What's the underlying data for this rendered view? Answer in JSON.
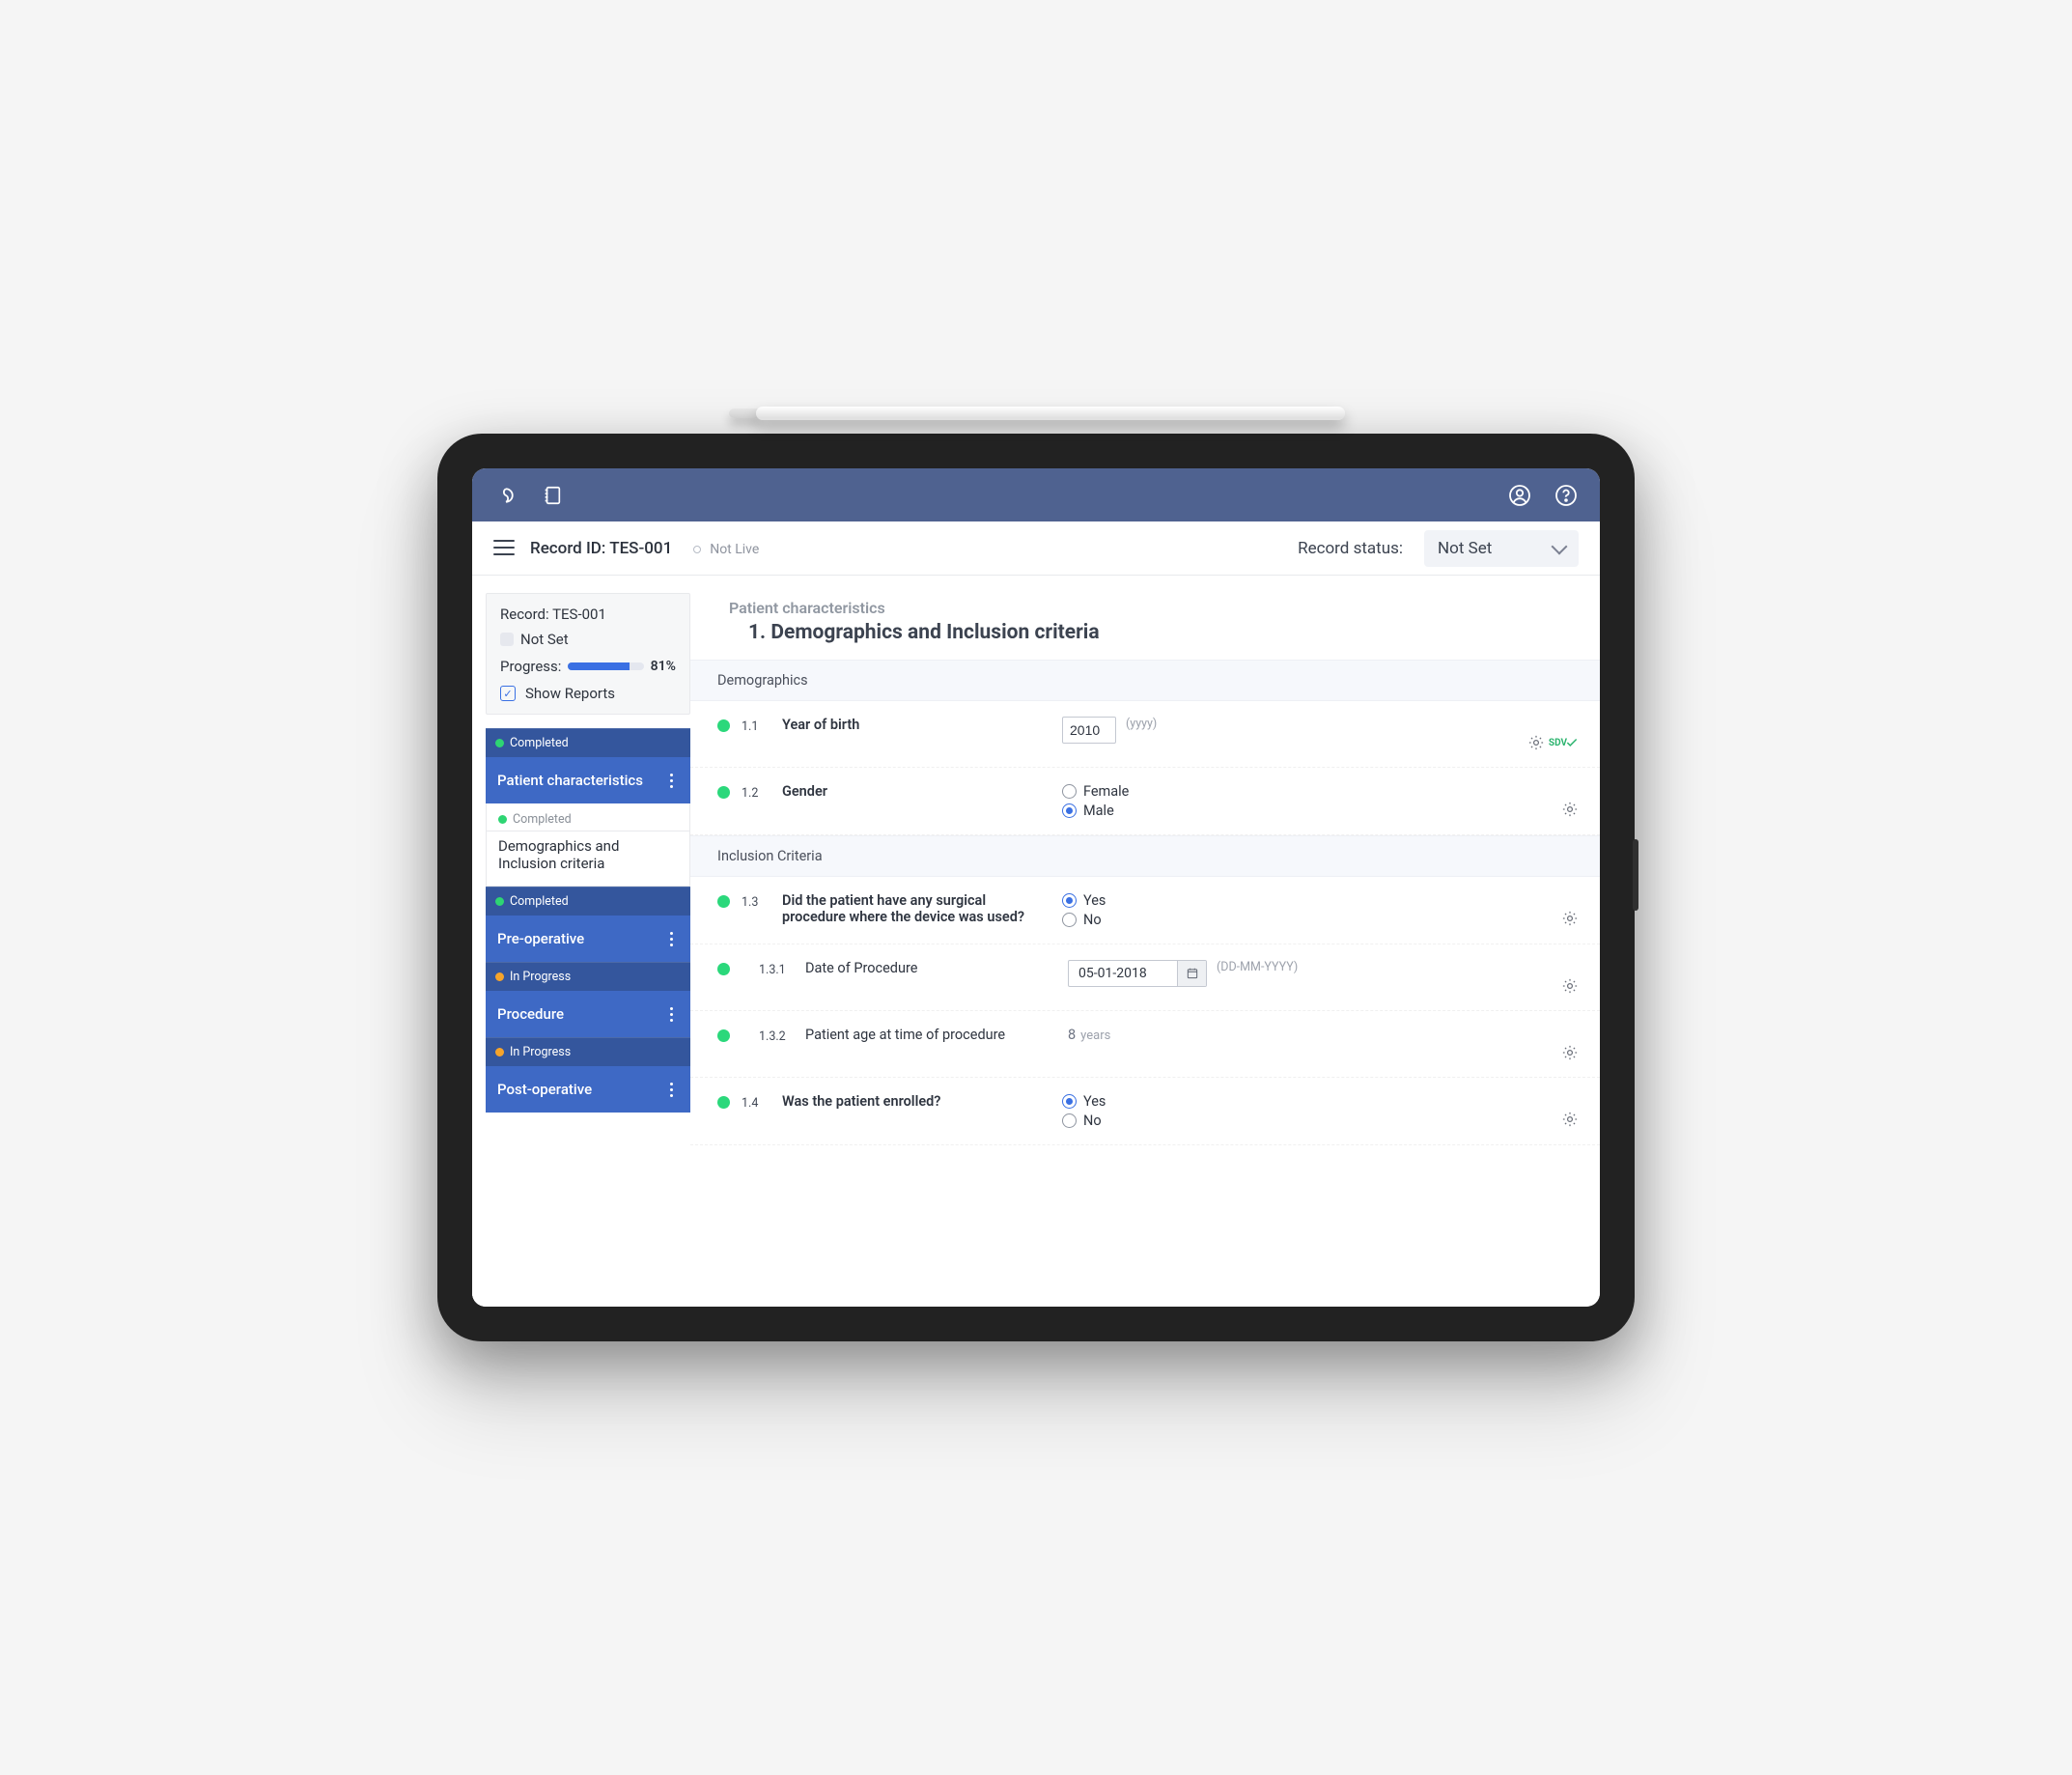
{
  "appbar": {},
  "toolbar": {
    "record_label": "Record ID: TES-001",
    "live_label": "Not Live",
    "status_label": "Record status:",
    "status_value": "Not Set"
  },
  "sidebar": {
    "record_title": "Record: TES-001",
    "status_notset": "Not Set",
    "progress_label": "Progress:",
    "progress_pct": "81%",
    "progress_fill_width": "81%",
    "show_reports_label": "Show Reports",
    "nav": [
      {
        "status_text": "Completed",
        "status_color": "green",
        "label": "Patient characteristics",
        "sub": {
          "status_text": "Completed",
          "label": "Demographics and Inclusion criteria"
        }
      },
      {
        "status_text": "Completed",
        "status_color": "green",
        "label": "Pre-operative"
      },
      {
        "status_text": "In Progress",
        "status_color": "orange",
        "label": "Procedure"
      },
      {
        "status_text": "In Progress",
        "status_color": "orange",
        "label": "Post-operative"
      }
    ]
  },
  "page": {
    "breadcrumb": "Patient characteristics",
    "title": "1. Demographics and Inclusion criteria",
    "sections": {
      "demographics": "Demographics",
      "inclusion": "Inclusion Criteria"
    }
  },
  "questions": {
    "yob": {
      "num": "1.1",
      "label": "Year of birth",
      "value": "2010",
      "hint": "(yyyy)"
    },
    "gender": {
      "num": "1.2",
      "label": "Gender",
      "options": [
        "Female",
        "Male"
      ],
      "selected": "Male"
    },
    "surgical": {
      "num": "1.3",
      "label": "Did the patient have any surgical procedure where the device was used?",
      "options": [
        "Yes",
        "No"
      ],
      "selected": "Yes"
    },
    "dop": {
      "num": "1.3.1",
      "label": "Date of Procedure",
      "value": "05-01-2018",
      "hint": "(DD-MM-YYYY)"
    },
    "age": {
      "num": "1.3.2",
      "label": "Patient age at time of procedure",
      "value": "8",
      "unit": " years"
    },
    "enrolled": {
      "num": "1.4",
      "label": "Was the patient enrolled?",
      "options": [
        "Yes",
        "No"
      ],
      "selected": "Yes"
    }
  },
  "sdv_label": "SDV"
}
